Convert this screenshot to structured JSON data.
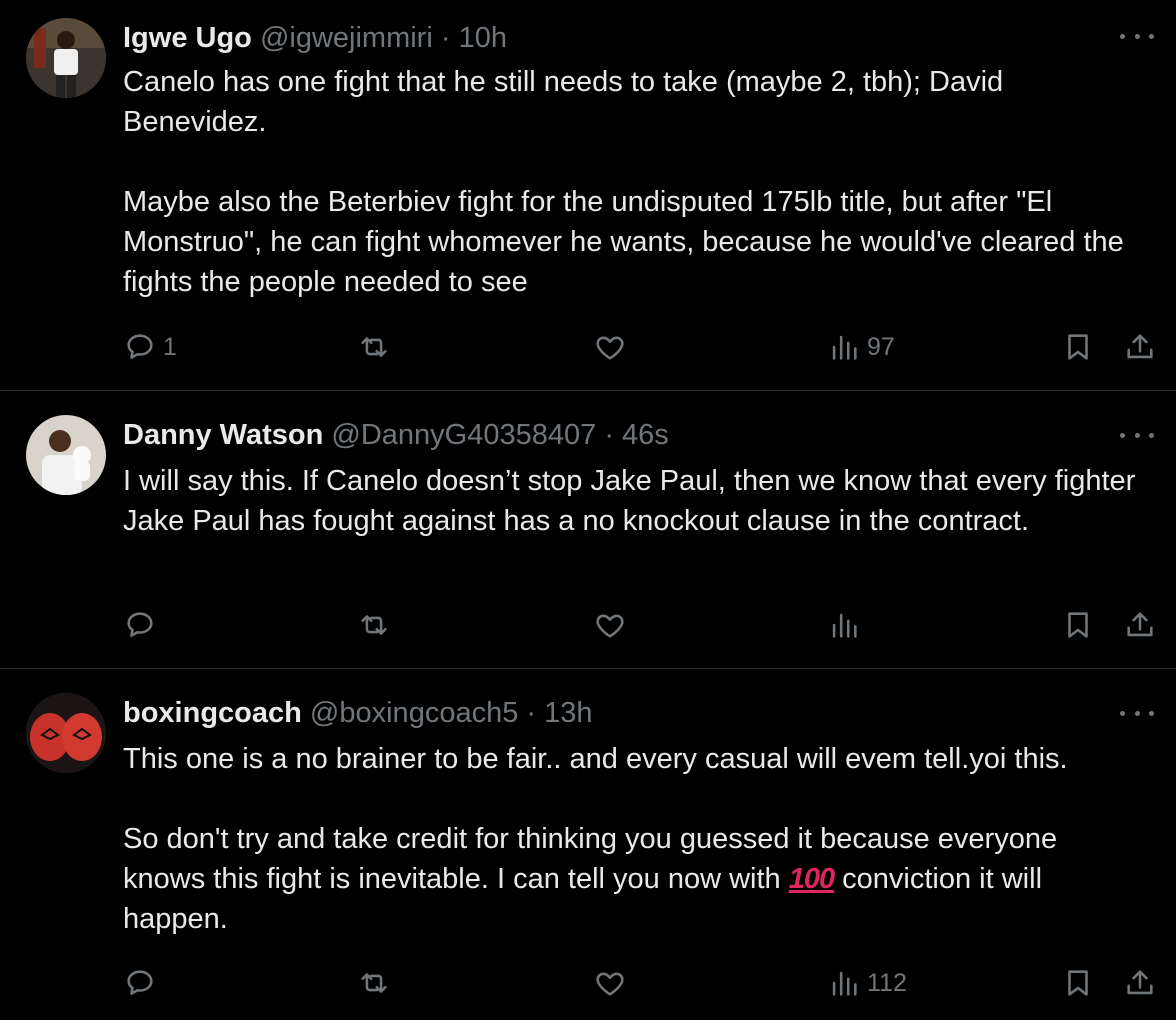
{
  "tweets": [
    {
      "name": "Igwe Ugo",
      "handle": "@igwejimmiri",
      "dot": "·",
      "time": "10h",
      "paragraphs": [
        "Canelo has one fight that he still needs to take (maybe 2, tbh); David Benevidez.",
        "Maybe also the Beterbiev fight for the undisputed 175lb title, but after \"El Monstruo\", he can fight whomever he wants, because he would've cleared the fights the people needed to see"
      ],
      "replies": "1",
      "retweets": "",
      "likes": "",
      "views": "97"
    },
    {
      "name": "Danny Watson",
      "handle": "@DannyG40358407",
      "dot": "·",
      "time": "46s",
      "paragraphs": [
        "I will say this. If Canelo doesn’t stop Jake Paul, then we know that every fighter Jake Paul has fought against has a no knockout clause in the contract."
      ],
      "replies": "",
      "retweets": "",
      "likes": "",
      "views": ""
    },
    {
      "name": "boxingcoach",
      "handle": "@boxingcoach5",
      "dot": "·",
      "time": "13h",
      "paragraph1": "This one is a no brainer to be fair..  and every casual will evem tell.yoi this.",
      "paragraph2_before": "So don't try and take credit for thinking you guessed it because everyone knows this fight is inevitable. I can tell you now with ",
      "emoji": "100",
      "paragraph2_after": " conviction it will happen.",
      "replies": "",
      "retweets": "",
      "likes": "",
      "views": "112"
    }
  ],
  "icons": {
    "reply": "speech-bubble-icon",
    "retweet": "retweet-arrows-icon",
    "like": "heart-icon",
    "views": "bar-chart-icon",
    "bookmark": "bookmark-icon",
    "share": "share-upload-icon",
    "more": "ellipsis-icon"
  },
  "colors": {
    "background": "#000000",
    "text": "#e7e9ea",
    "muted": "#71767b",
    "divider": "#2f3336",
    "emoji": "#e0245e"
  }
}
